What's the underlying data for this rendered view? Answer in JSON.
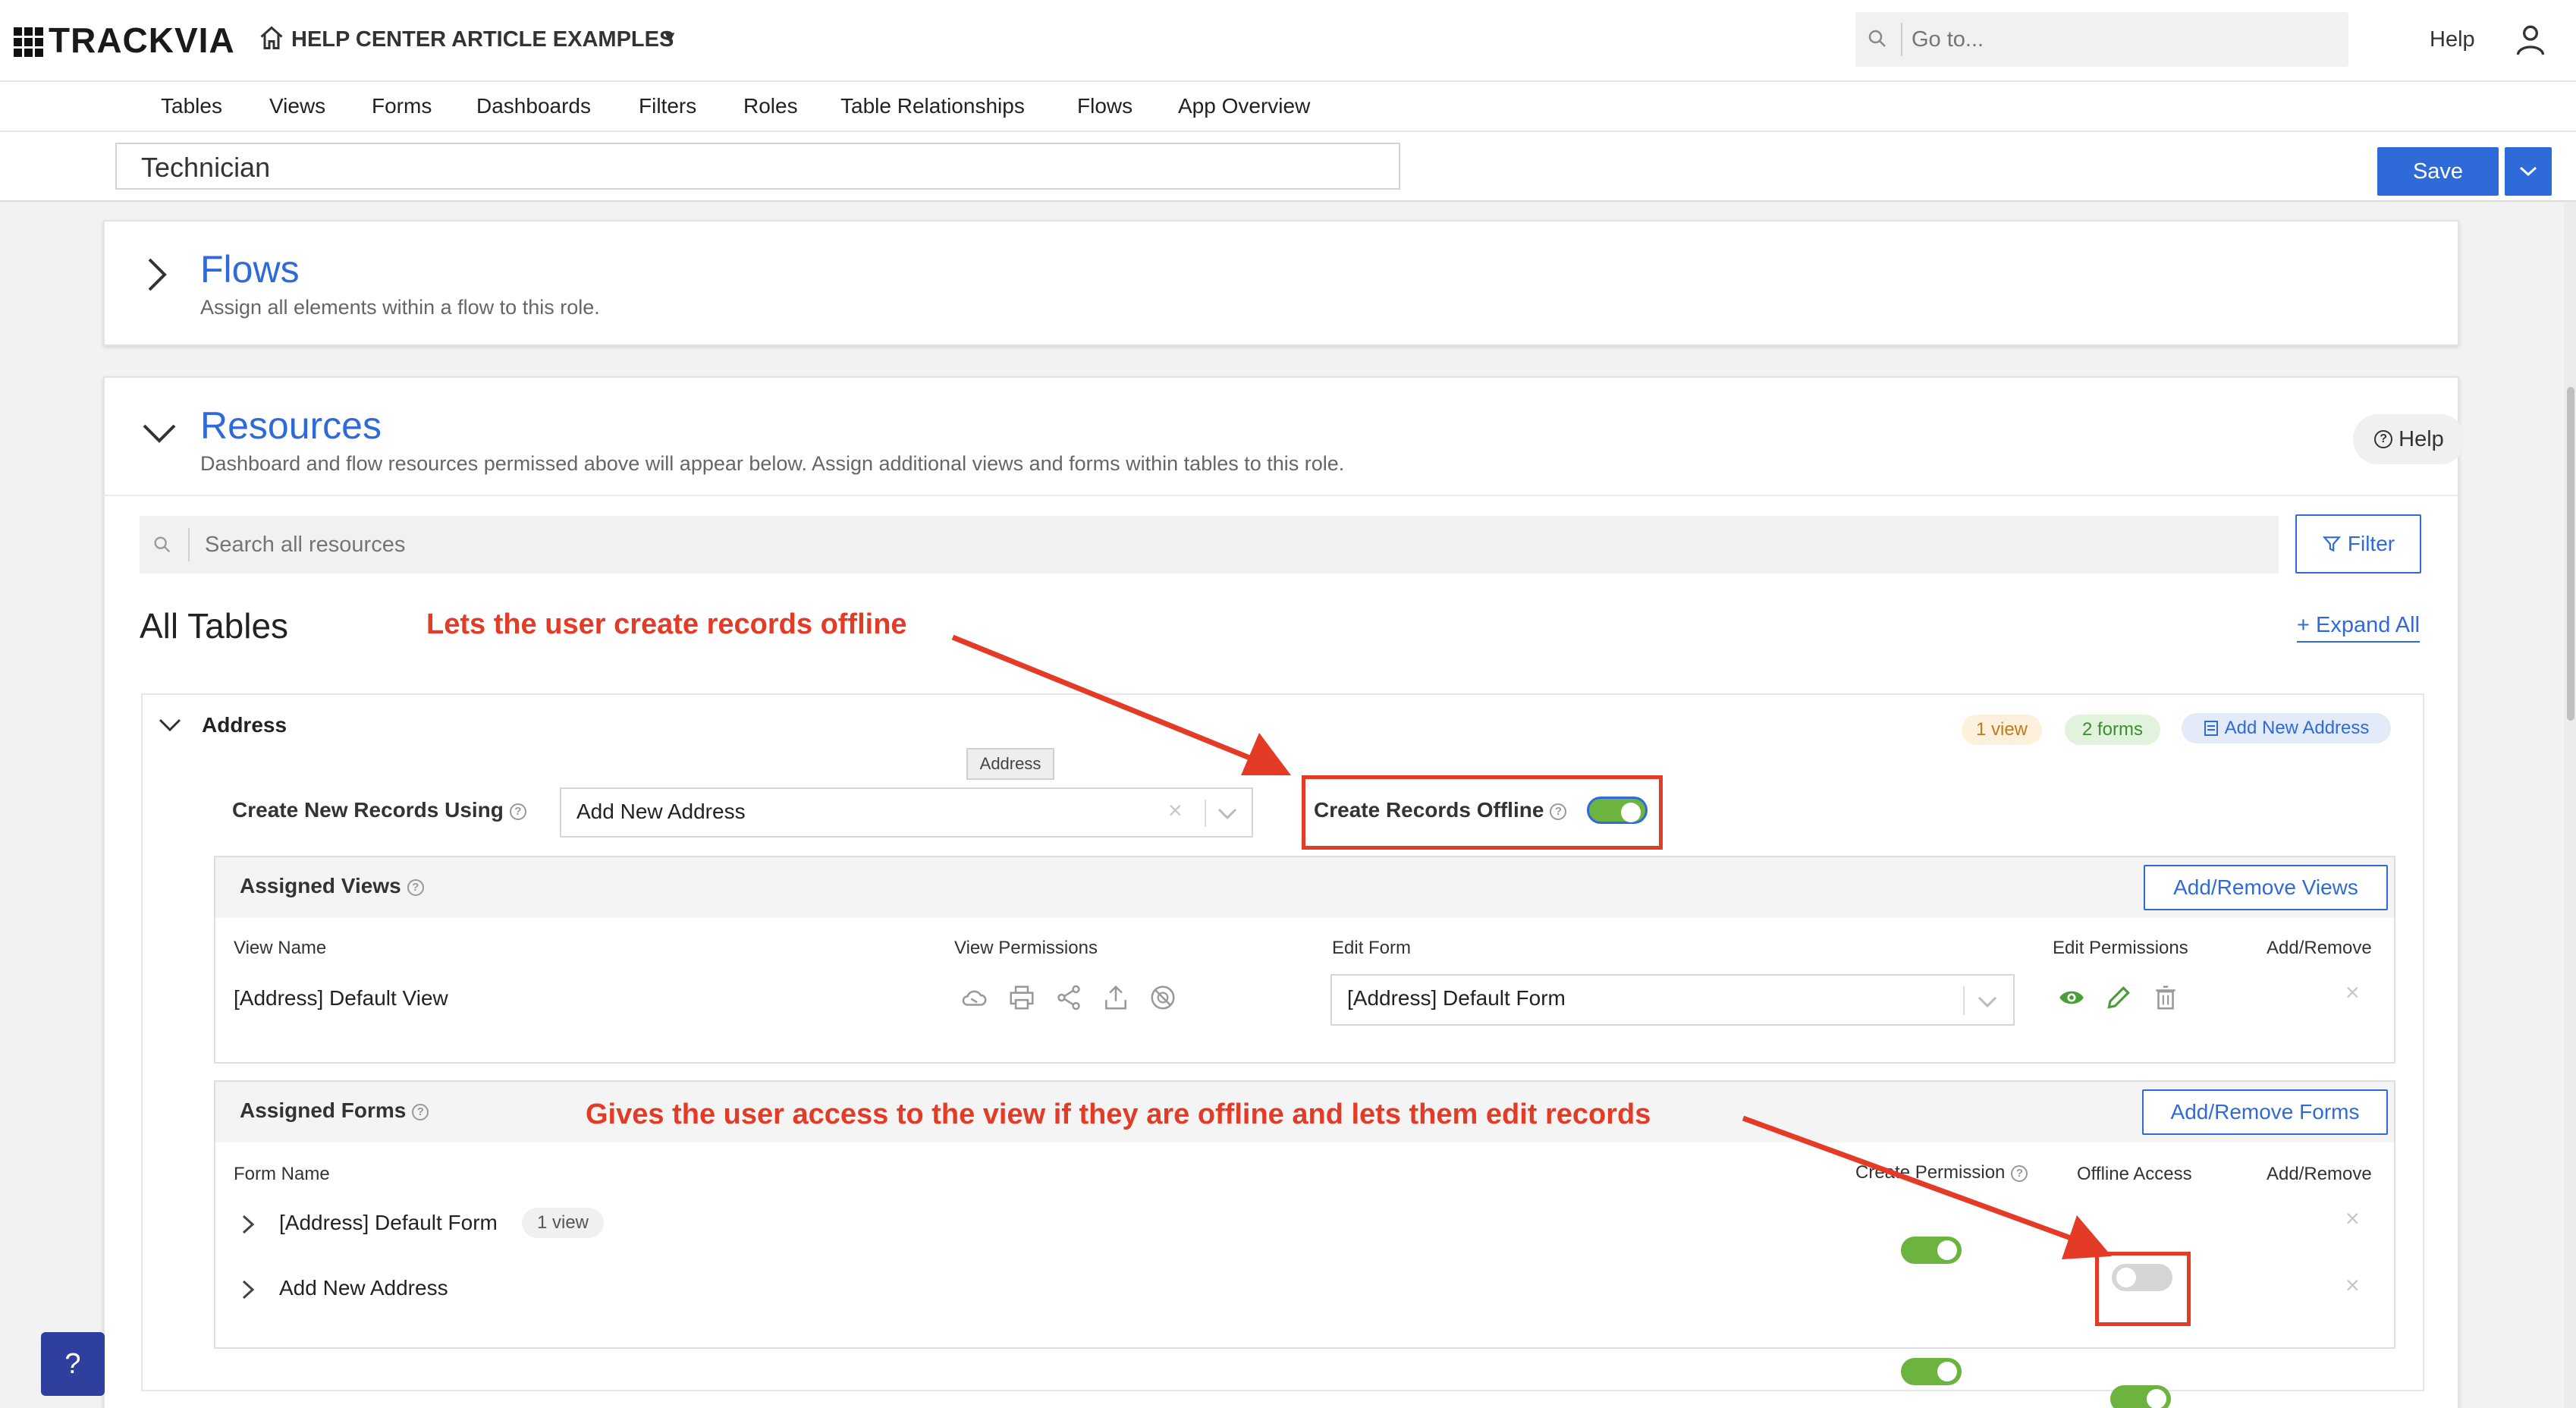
{
  "app": {
    "brand": "TRACKVIA",
    "app_name": "HELP CENTER ARTICLE EXAMPLES",
    "search_placeholder": "Go to...",
    "help_label": "Help"
  },
  "nav": {
    "items": [
      "Tables",
      "Views",
      "Forms",
      "Dashboards",
      "Filters",
      "Roles",
      "Table Relationships",
      "Flows",
      "App Overview"
    ]
  },
  "role": {
    "name": "Technician",
    "save_label": "Save"
  },
  "flows_section": {
    "title": "Flows",
    "subtitle": "Assign all elements within a flow to this role."
  },
  "resources_section": {
    "title": "Resources",
    "subtitle": "Dashboard and flow resources permissed above will appear below. Assign additional views and forms within tables to this role.",
    "help_label": "Help",
    "search_placeholder": "Search all resources",
    "filter_label": "Filter",
    "all_tables_label": "All Tables",
    "expand_all_label": "+ Expand All"
  },
  "table": {
    "name": "Address",
    "tooltip": "Address",
    "view_count_badge": "1 view",
    "form_count_badge": "2 forms",
    "add_form_badge": "Add New Address",
    "create_using_label": "Create New Records Using",
    "create_using_value": "Add New Address",
    "create_offline_label": "Create Records Offline",
    "create_offline_on": true
  },
  "assigned_views": {
    "title": "Assigned Views",
    "button": "Add/Remove Views",
    "columns": [
      "View Name",
      "View Permissions",
      "Edit Form",
      "Edit Permissions",
      "Add/Remove"
    ],
    "rows": [
      {
        "name": "[Address] Default View",
        "edit_form": "[Address] Default Form"
      }
    ]
  },
  "assigned_forms": {
    "title": "Assigned Forms",
    "button": "Add/Remove Forms",
    "columns": [
      "Form Name",
      "Create Permission",
      "Offline Access",
      "Add/Remove"
    ],
    "rows": [
      {
        "name": "[Address] Default Form",
        "badge": "1 view",
        "create_permission": true,
        "offline_access": false
      },
      {
        "name": "Add New Address",
        "badge": "",
        "create_permission": true,
        "offline_access": true
      }
    ]
  },
  "annotations": {
    "offline_note": "Lets the user create records offline",
    "access_note": "Gives the user access to the view if they are offline and lets them edit records"
  },
  "colors": {
    "accent": "#2f6bd8",
    "annotation": "#e33b26",
    "toggle_on": "#6db33f"
  }
}
